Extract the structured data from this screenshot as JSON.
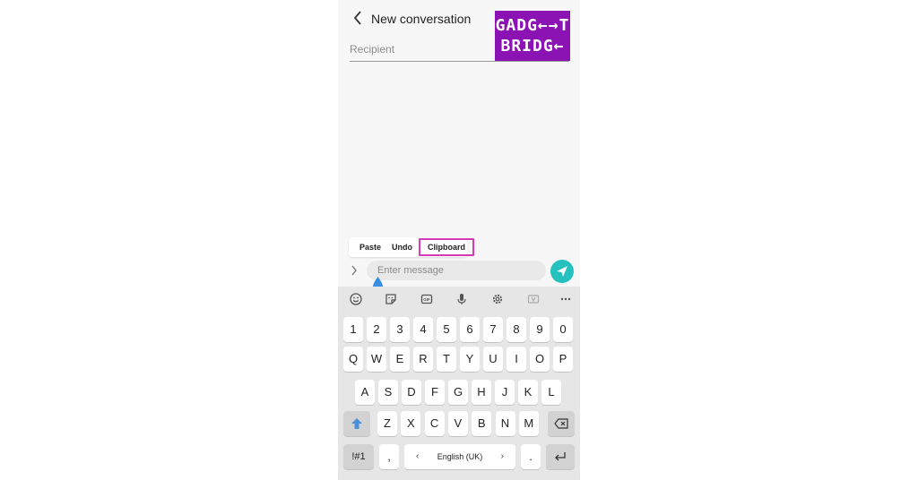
{
  "header": {
    "title": "New conversation"
  },
  "logo": {
    "line1": "GADG←→T",
    "line2": "BRIDG←"
  },
  "recipient": {
    "placeholder": "Recipient"
  },
  "context_menu": {
    "paste": "Paste",
    "undo": "Undo",
    "clipboard": "Clipboard"
  },
  "compose": {
    "placeholder": "Enter message"
  },
  "keyboard": {
    "numbers": [
      "1",
      "2",
      "3",
      "4",
      "5",
      "6",
      "7",
      "8",
      "9",
      "0"
    ],
    "row1": [
      "Q",
      "W",
      "E",
      "R",
      "T",
      "Y",
      "U",
      "I",
      "O",
      "P"
    ],
    "row2": [
      "A",
      "S",
      "D",
      "F",
      "G",
      "H",
      "J",
      "K",
      "L"
    ],
    "row3": [
      "Z",
      "X",
      "C",
      "V",
      "B",
      "N",
      "M"
    ],
    "symbols_label": "!#1",
    "comma": ",",
    "period": ".",
    "language_label": "English (UK)",
    "lang_prev": "‹",
    "lang_next": "›"
  },
  "icons": {
    "back": "chevron-left-icon",
    "expand": "chevron-right-icon",
    "send": "send-icon",
    "emoji": "emoji-icon",
    "sticker": "sticker-icon",
    "gif": "gif-icon",
    "mic": "mic-icon",
    "settings": "gear-icon",
    "translate": "translate-icon",
    "more": "more-icon",
    "shift": "shift-icon",
    "backspace": "backspace-icon",
    "enter": "enter-icon"
  },
  "colors": {
    "logo_bg": "#8b12b3",
    "highlight": "#d63bb5",
    "send": "#24c1be",
    "keyboard_bg": "#e6e6e6"
  }
}
